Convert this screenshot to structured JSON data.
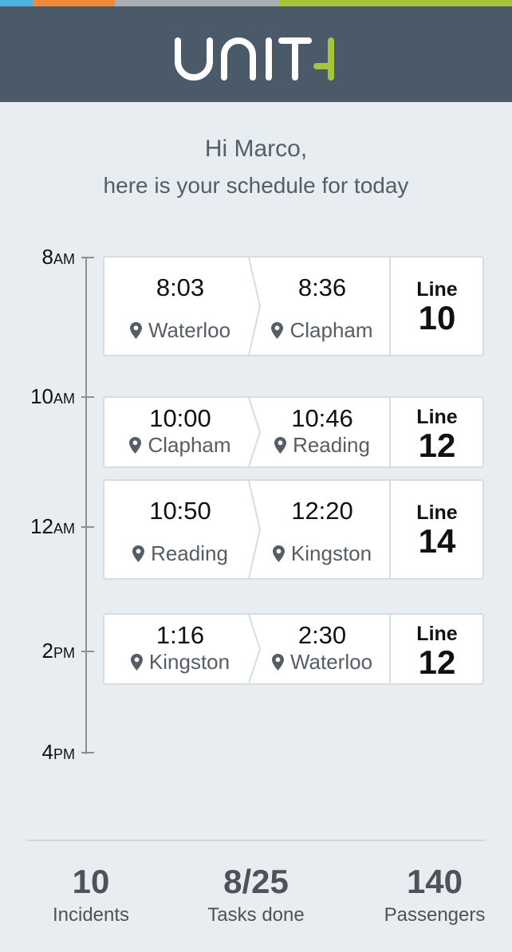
{
  "colors": {
    "strip": [
      "#4eb3e3",
      "#f08a3a",
      "#a9afb3",
      "#a7c43a"
    ],
    "header_bg": "#4a5a69",
    "logo_white": "#ffffff",
    "logo_accent": "#a7c43a"
  },
  "header": {
    "logo_text": "UNIT4"
  },
  "greeting": {
    "line1": "Hi Marco,",
    "line2": "here is your schedule for today"
  },
  "timeline": {
    "labels": [
      {
        "hour": "8",
        "suffix": "AM"
      },
      {
        "hour": "10",
        "suffix": "AM"
      },
      {
        "hour": "12",
        "suffix": "AM"
      },
      {
        "hour": "2",
        "suffix": "PM"
      },
      {
        "hour": "4",
        "suffix": "PM"
      }
    ]
  },
  "trips": [
    {
      "depart_time": "8:03",
      "depart_place": "Waterloo",
      "arrive_time": "8:36",
      "arrive_place": "Clapham",
      "line_word": "Line",
      "line_number": "10"
    },
    {
      "depart_time": "10:00",
      "depart_place": "Clapham",
      "arrive_time": "10:46",
      "arrive_place": "Reading",
      "line_word": "Line",
      "line_number": "12"
    },
    {
      "depart_time": "10:50",
      "depart_place": "Reading",
      "arrive_time": "12:20",
      "arrive_place": "Kingston",
      "line_word": "Line",
      "line_number": "14"
    },
    {
      "depart_time": "1:16",
      "depart_place": "Kingston",
      "arrive_time": "2:30",
      "arrive_place": "Waterloo",
      "line_word": "Line",
      "line_number": "12"
    }
  ],
  "stats": [
    {
      "value": "10",
      "label": "Incidents"
    },
    {
      "value": "8/25",
      "label": "Tasks done"
    },
    {
      "value": "140",
      "label": "Passengers"
    }
  ]
}
